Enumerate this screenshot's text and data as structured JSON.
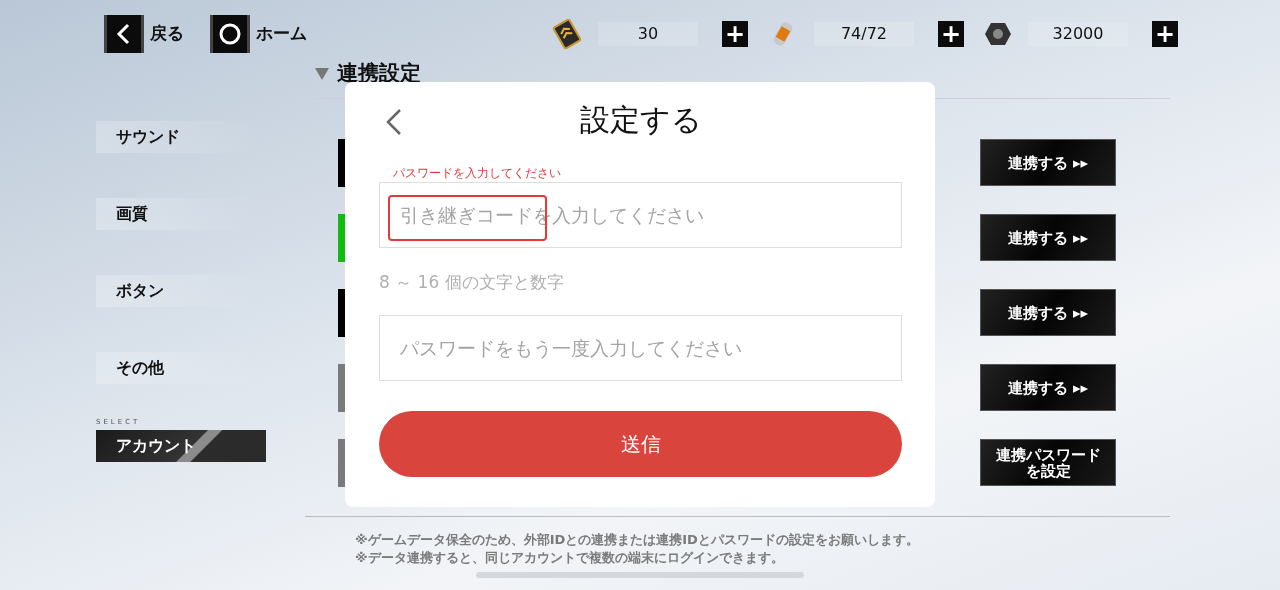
{
  "top_bar": {
    "back": {
      "label": "戻る"
    },
    "home": {
      "label": "ホーム"
    },
    "resources": [
      {
        "kind": "ticket",
        "value": "30",
        "plus": "+"
      },
      {
        "kind": "capsule",
        "value": "74/72",
        "plus": "+"
      },
      {
        "kind": "nut",
        "value": "32000",
        "plus": "+"
      }
    ]
  },
  "sidebar": {
    "select_label": "SELECT",
    "items": [
      {
        "label": "サウンド",
        "selected": false
      },
      {
        "label": "画質",
        "selected": false
      },
      {
        "label": "ボタン",
        "selected": false
      },
      {
        "label": "その他",
        "selected": false
      },
      {
        "label": "アカウント",
        "selected": true
      }
    ]
  },
  "section": {
    "title": "連携設定",
    "rows": [
      {
        "color": "#000000",
        "button": "連携する ▸▸"
      },
      {
        "color": "#11bb11",
        "button": "連携する ▸▸"
      },
      {
        "color": "#000000",
        "button": "連携する ▸▸"
      },
      {
        "color": "#7a7a7a",
        "button": "連携する ▸▸"
      },
      {
        "color": "#7a7a7a",
        "button": "連携パスワードを設定"
      }
    ]
  },
  "notes": [
    "※ゲームデータ保全のため、外部IDとの連携または連携IDとパスワードの設定をお願いします。",
    "※データ連携すると、同じアカウントで複数の端末にログインできます。"
  ],
  "dialog": {
    "title": "設定する",
    "code_field": {
      "floating_label": "パスワードを入力してください",
      "placeholder": "引き継ぎコードを入力してください",
      "highlighted": true
    },
    "hint": "8 ～ 16 個の文字と数字",
    "confirm_field": {
      "placeholder": "パスワードをもう一度入力してください"
    },
    "submit": "送信"
  }
}
